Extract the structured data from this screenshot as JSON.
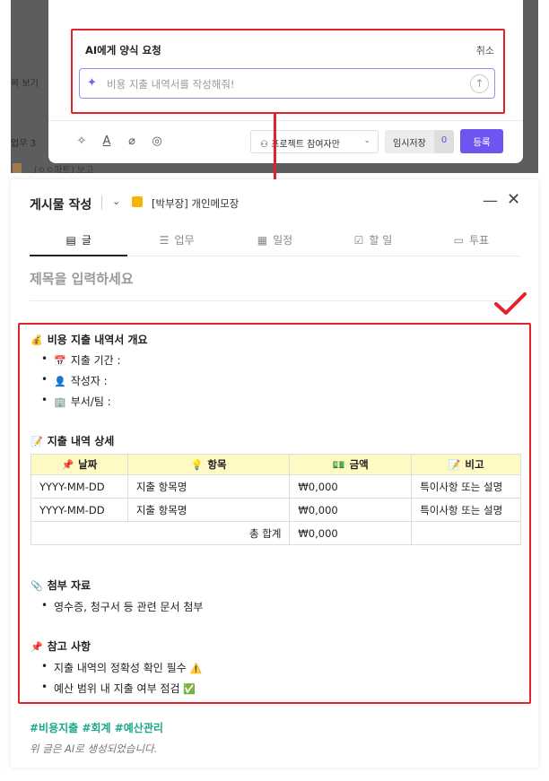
{
  "background": {
    "peek_1": "목 보기",
    "peek_2": "업무 3",
    "peek_3": "[ㅇㅇ파트] 보고"
  },
  "ai_request": {
    "title": "AI에게 양식 요청",
    "cancel_label": "취소",
    "input_placeholder": "비용 지출 내역서를 작성해줘!"
  },
  "composer": {
    "scope_label": "프로젝트 참여자만",
    "temp_save_label": "임시저장",
    "temp_save_count": "0",
    "submit_label": "등록"
  },
  "post": {
    "header_title": "게시물 작성",
    "board_name": "[박부장] 개인메모장",
    "tabs": [
      {
        "label": "글",
        "icon": "document-icon"
      },
      {
        "label": "업무",
        "icon": "list-icon"
      },
      {
        "label": "일정",
        "icon": "calendar-icon"
      },
      {
        "label": "할 일",
        "icon": "checkbox-icon"
      },
      {
        "label": "투표",
        "icon": "vote-icon"
      }
    ],
    "active_tab": "글",
    "subject_placeholder": "제목을 입력하세요"
  },
  "document": {
    "section1": {
      "emoji": "💰",
      "title": "비용 지출 내역서 개요",
      "items": [
        {
          "emoji": "📅",
          "text": "지출 기간 :"
        },
        {
          "emoji": "👤",
          "text": "작성자 :"
        },
        {
          "emoji": "🏢",
          "text": "부서/팀 :"
        }
      ]
    },
    "section2": {
      "emoji": "📝",
      "title": "지출 내역 상세",
      "columns": [
        {
          "emoji": "📌",
          "label": "날짜"
        },
        {
          "emoji": "💡",
          "label": "항목"
        },
        {
          "emoji": "💵",
          "label": "금액"
        },
        {
          "emoji": "📝",
          "label": "비고"
        }
      ],
      "rows": [
        [
          "YYYY-MM-DD",
          "지출 항목명",
          "₩0,000",
          "특이사항 또는 설명"
        ],
        [
          "YYYY-MM-DD",
          "지출 항목명",
          "₩0,000",
          "특이사항 또는 설명"
        ]
      ],
      "total_label": "총 합계",
      "total_value": "₩0,000"
    },
    "section3": {
      "emoji": "📎",
      "title": "첨부 자료",
      "items": [
        {
          "text": "영수증, 청구서 등 관련 문서 첨부"
        }
      ]
    },
    "section4": {
      "emoji": "📌",
      "title": "참고 사항",
      "items": [
        {
          "text": "지출 내역의 정확성 확인 필수",
          "emoji": "⚠️"
        },
        {
          "text": "예산 범위 내 지출 여부 점검",
          "emoji": "✅"
        }
      ]
    }
  },
  "footer": {
    "hashtags": "#비용지출 #회계 #예산관리",
    "ai_note": "위 글은 AI로 생성되었습니다."
  },
  "colors": {
    "highlight_red": "#e3232c",
    "primary_purple": "#6d55f2",
    "tag_green": "#1aa88c",
    "table_header_yellow": "#fff9c4"
  }
}
